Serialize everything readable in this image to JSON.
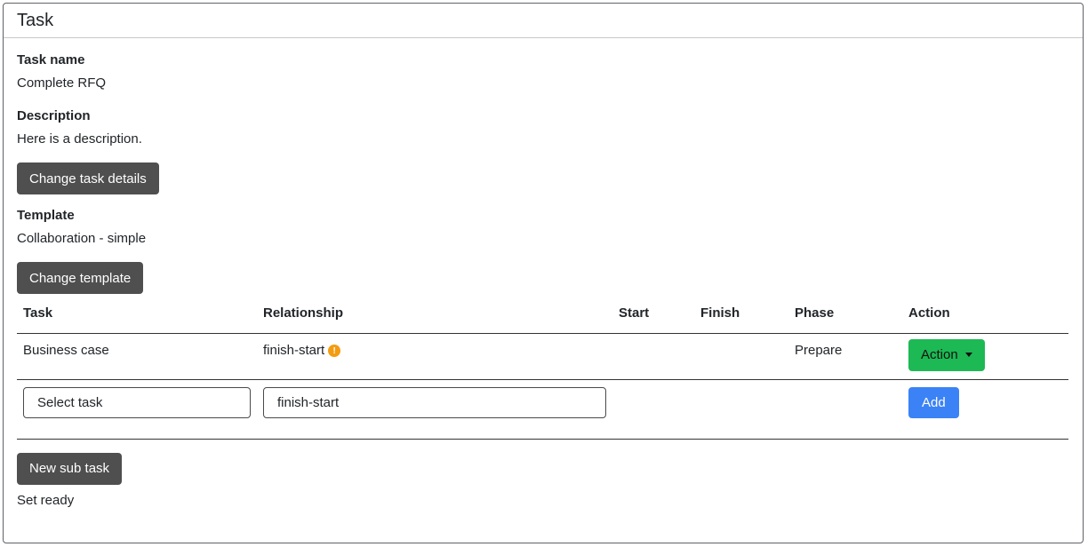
{
  "card": {
    "title": "Task"
  },
  "fields": {
    "task_name_label": "Task name",
    "task_name_value": "Complete RFQ",
    "description_label": "Description",
    "description_value": "Here is a description.",
    "change_details_label": "Change task details",
    "template_label": "Template",
    "template_value": "Collaboration - simple",
    "change_template_label": "Change template"
  },
  "table": {
    "headers": [
      "Task",
      "Relationship",
      "Start",
      "Finish",
      "Phase",
      "Action"
    ],
    "rows": [
      {
        "task": "Business case",
        "relationship": "finish-start",
        "warning_icon": "exclamation-circle-icon",
        "start": "",
        "finish": "",
        "phase": "Prepare",
        "action_label": "Action"
      }
    ],
    "input_row": {
      "task_select_value": "Select task",
      "relationship_select_value": "finish-start",
      "add_label": "Add"
    }
  },
  "footer": {
    "new_sub_task_label": "New sub task",
    "status_text": "Set ready"
  },
  "colors": {
    "action_button": "#1db954",
    "add_button": "#3b82f6",
    "dark_button": "#4f4f4f",
    "warning": "#f39c12"
  }
}
